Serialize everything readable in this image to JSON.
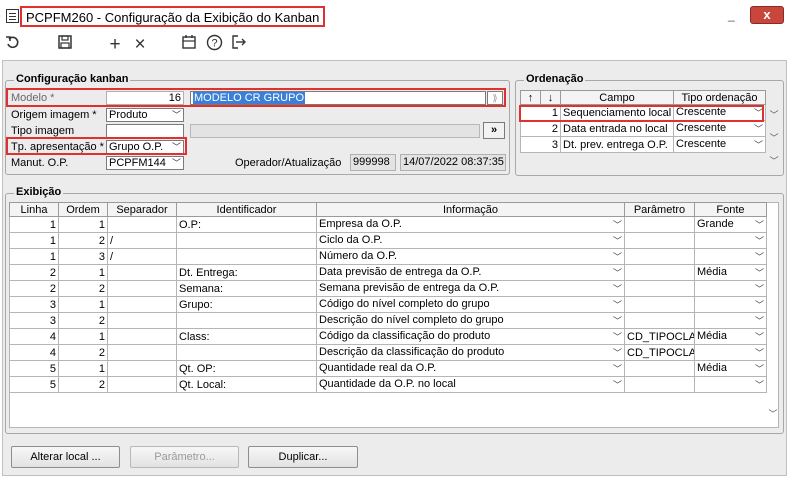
{
  "window": {
    "title": "PCPFM260 - Configuração da Exibição do Kanban",
    "close_label": "x",
    "minimize_label": "_"
  },
  "toolbar": {
    "undo_icon": "undo-icon",
    "save_icon": "save-icon",
    "add_label": "+",
    "delete_label": "×",
    "calendar_icon": "calendar-icon",
    "help_label": "?",
    "exit_icon": "exit-icon"
  },
  "config": {
    "legend": "Configuração kanban",
    "modelo_label": "Modelo *",
    "modelo_value": "16",
    "modelo_desc": "MODELO CR GRUPO",
    "origem_label": "Origem imagem *",
    "origem_value": "Produto",
    "tipo_label": "Tipo imagem",
    "tipo_value": "",
    "tipo_btn": "»",
    "tp_label": "Tp. apresentação *",
    "tp_value": "Grupo O.P.",
    "manut_label": "Manut. O.P.",
    "manut_value": "PCPFM144",
    "operador_label": "Operador/Atualização",
    "operador_value": "999998",
    "data_value": "14/07/2022 08:37:35"
  },
  "ordenacao": {
    "legend": "Ordenação",
    "up": "↑",
    "down": "↓",
    "col_campo": "Campo",
    "col_tipo": "Tipo ordenação",
    "rows": [
      {
        "n": "1",
        "campo": "Sequenciamento local",
        "tipo": "Crescente"
      },
      {
        "n": "2",
        "campo": "Data entrada no local",
        "tipo": "Crescente"
      },
      {
        "n": "3",
        "campo": "Dt. prev. entrega O.P.",
        "tipo": "Crescente"
      }
    ]
  },
  "exibicao": {
    "legend": "Exibição",
    "headers": [
      "Linha",
      "Ordem",
      "Separador",
      "Identificador",
      "Informação",
      "Parâmetro",
      "Fonte"
    ],
    "rows": [
      [
        "1",
        "1",
        "",
        "O.P:",
        "Empresa da O.P.",
        "",
        "Grande"
      ],
      [
        "1",
        "2",
        "/",
        "",
        "Ciclo da O.P.",
        "",
        ""
      ],
      [
        "1",
        "3",
        "/",
        "",
        "Número da O.P.",
        "",
        ""
      ],
      [
        "2",
        "1",
        "",
        "Dt. Entrega:",
        "Data previsão de entrega da O.P.",
        "",
        "Média"
      ],
      [
        "2",
        "2",
        "",
        "Semana:",
        "Semana previsão de entrega da O.P.",
        "",
        ""
      ],
      [
        "3",
        "1",
        "",
        "Grupo:",
        "Código do nível completo do grupo",
        "",
        ""
      ],
      [
        "3",
        "2",
        "",
        "",
        "Descrição do nível completo do grupo",
        "",
        ""
      ],
      [
        "4",
        "1",
        "",
        "Class:",
        "Código da classificação do produto",
        "CD_TIPOCLAS",
        "Média"
      ],
      [
        "4",
        "2",
        "",
        "",
        "Descrição da classificação do produto",
        "CD_TIPOCLAS",
        ""
      ],
      [
        "5",
        "1",
        "",
        "Qt. OP:",
        "Quantidade real da O.P.",
        "",
        "Média"
      ],
      [
        "5",
        "2",
        "",
        "Qt. Local:",
        "Quantidade da O.P. no local",
        "",
        ""
      ]
    ]
  },
  "buttons": {
    "alterar": "Alterar local ...",
    "parametro": "Parâmetro...",
    "duplicar": "Duplicar..."
  }
}
